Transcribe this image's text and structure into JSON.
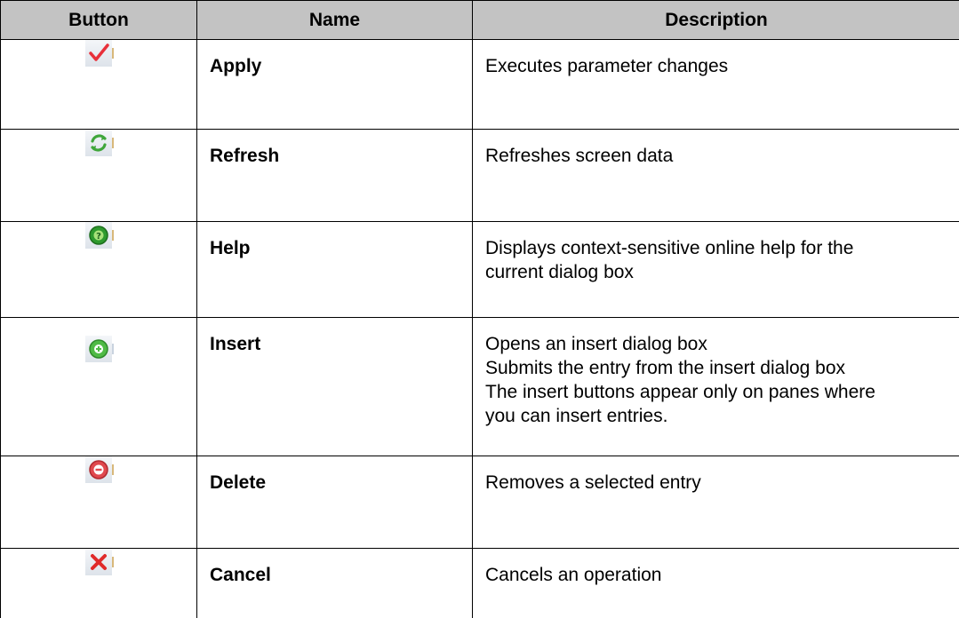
{
  "table": {
    "headers": {
      "button": "Button",
      "name": "Name",
      "description": "Description"
    },
    "rows": [
      {
        "icon": "apply-checkmark-icon",
        "name": "Apply",
        "description": [
          "Executes parameter changes"
        ]
      },
      {
        "icon": "refresh-arrows-icon",
        "name": "Refresh",
        "description": [
          "Refreshes screen data"
        ]
      },
      {
        "icon": "help-question-icon",
        "name": "Help",
        "description": [
          "Displays context-sensitive online help for the",
          "current dialog box"
        ]
      },
      {
        "icon": "insert-plus-icon",
        "name": "Insert",
        "description": [
          "Opens an insert dialog box",
          "Submits the entry from the insert dialog box",
          "The insert buttons appear only on panes where",
          "you can insert entries."
        ]
      },
      {
        "icon": "delete-minus-icon",
        "name": "Delete",
        "description": [
          "Removes a selected entry"
        ]
      },
      {
        "icon": "cancel-x-icon",
        "name": "Cancel",
        "description": [
          "Cancels an operation"
        ]
      }
    ]
  },
  "colors": {
    "header_bg": "#c3c3c3",
    "border": "#000000",
    "check_red": "#e8303a",
    "refresh_green": "#3fa63a",
    "help_green": "#2e9a2e",
    "insert_green": "#4fba45",
    "delete_red": "#e0484e",
    "cancel_red": "#e02a2a"
  }
}
